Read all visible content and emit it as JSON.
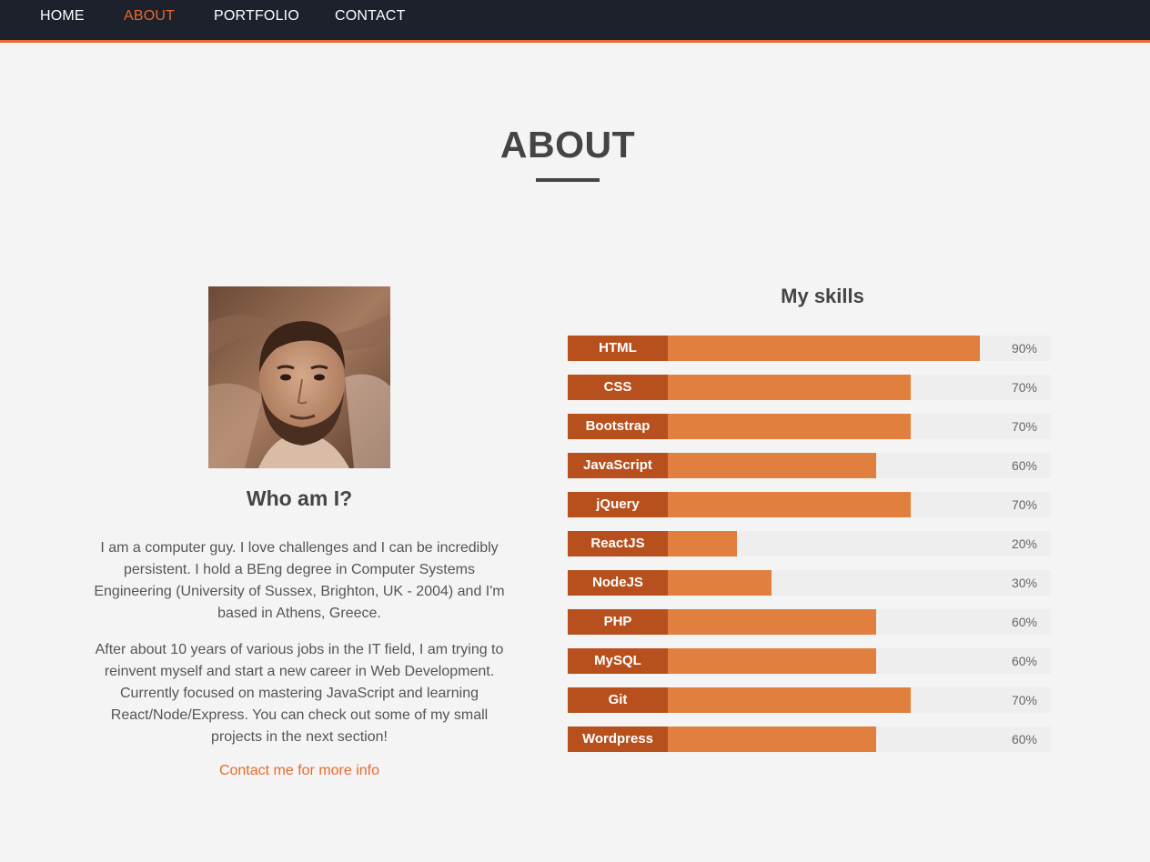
{
  "nav": {
    "items": [
      {
        "label": "HOME",
        "active": false
      },
      {
        "label": "ABOUT",
        "active": true
      },
      {
        "label": "PORTFOLIO",
        "active": false
      },
      {
        "label": "CONTACT",
        "active": false
      }
    ]
  },
  "about": {
    "title": "ABOUT",
    "who_title": "Who am I?",
    "bio_1": "I am a computer guy. I love challenges and I can be incredibly persistent. I hold a BEng degree in Computer Systems Engineering (University of Sussex, Brighton, UK - 2004) and I'm based in Athens, Greece.",
    "bio_2": "After about 10 years of various jobs in the IT field, I am trying to reinvent myself and start a new career in Web Development. Currently focused on mastering JavaScript and learning React/Node/Express. You can check out some of my small projects in the next section!",
    "contact_link": "Contact me for more info"
  },
  "skills": {
    "title": "My skills",
    "items": [
      {
        "name": "HTML",
        "level": 90,
        "label": "90%"
      },
      {
        "name": "CSS",
        "level": 70,
        "label": "70%"
      },
      {
        "name": "Bootstrap",
        "level": 70,
        "label": "70%"
      },
      {
        "name": "JavaScript",
        "level": 60,
        "label": "60%"
      },
      {
        "name": "jQuery",
        "level": 70,
        "label": "70%"
      },
      {
        "name": "ReactJS",
        "level": 20,
        "label": "20%"
      },
      {
        "name": "NodeJS",
        "level": 30,
        "label": "30%"
      },
      {
        "name": "PHP",
        "level": 60,
        "label": "60%"
      },
      {
        "name": "MySQL",
        "level": 60,
        "label": "60%"
      },
      {
        "name": "Git",
        "level": 70,
        "label": "70%"
      },
      {
        "name": "Wordpress",
        "level": 60,
        "label": "60%"
      }
    ]
  },
  "colors": {
    "accent": "#e86a2c",
    "nav_bg": "#1c212c",
    "skill_label_bg": "#b7501d",
    "skill_fill": "#e07f3e"
  }
}
